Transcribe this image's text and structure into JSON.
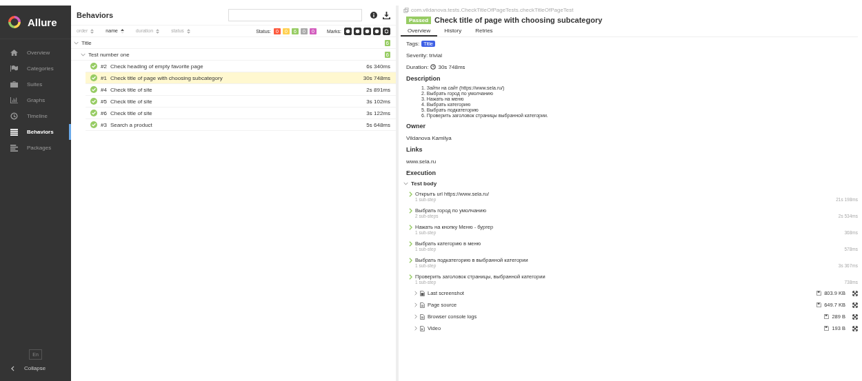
{
  "sidebar": {
    "brand": "Allure",
    "items": [
      {
        "label": "Overview",
        "selected": false
      },
      {
        "label": "Categories",
        "selected": false
      },
      {
        "label": "Suites",
        "selected": false
      },
      {
        "label": "Graphs",
        "selected": false
      },
      {
        "label": "Timeline",
        "selected": false
      },
      {
        "label": "Behaviors",
        "selected": true
      },
      {
        "label": "Packages",
        "selected": false
      }
    ],
    "language": "En",
    "collapse": "Collapse"
  },
  "tree_panel": {
    "title": "Behaviors",
    "sort": [
      {
        "label": "order",
        "selected": false
      },
      {
        "label": "name",
        "selected": true
      },
      {
        "label": "duration",
        "selected": false
      },
      {
        "label": "status",
        "selected": false
      }
    ],
    "status_label": "Status:",
    "status_counts": [
      {
        "value": "0",
        "color": "#fd5a3e"
      },
      {
        "value": "0",
        "color": "#ffd050"
      },
      {
        "value": "6",
        "color": "#97cc64"
      },
      {
        "value": "0",
        "color": "#aaaaaa"
      },
      {
        "value": "0",
        "color": "#d35ebe"
      }
    ],
    "marks_label": "Marks:",
    "marks": [
      {
        "checked": true
      },
      {
        "checked": true
      },
      {
        "checked": true
      },
      {
        "checked": true
      },
      {
        "checked": true
      }
    ],
    "groups": [
      {
        "name": "Title",
        "count": "6",
        "expanded": true,
        "children": [
          {
            "name": "Test number one",
            "count": "6",
            "expanded": true,
            "tests": [
              {
                "index": "#2",
                "name": "Check heading of empty favorite page",
                "duration": "6s 340ms",
                "selected": false
              },
              {
                "index": "#1",
                "name": "Check title of page with choosing subcategory",
                "duration": "30s 748ms",
                "selected": true
              },
              {
                "index": "#4",
                "name": "Check title of site",
                "duration": "2s 891ms",
                "selected": false
              },
              {
                "index": "#5",
                "name": "Check title of site",
                "duration": "3s 102ms",
                "selected": false
              },
              {
                "index": "#6",
                "name": "Check title of site",
                "duration": "3s 122ms",
                "selected": false
              },
              {
                "index": "#3",
                "name": "Search a product",
                "duration": "5s 648ms",
                "selected": false
              }
            ]
          }
        ]
      }
    ]
  },
  "detail": {
    "path": "com.vildanova.tests.CheckTitleOfPageTests.checkTitleOfPageTest",
    "status": "Passed",
    "title": "Check title of page with choosing subcategory",
    "tabs": [
      {
        "label": "Overview",
        "selected": true
      },
      {
        "label": "History",
        "selected": false
      },
      {
        "label": "Retries",
        "selected": false
      }
    ],
    "tags_label": "Tags:",
    "tags": [
      "Title"
    ],
    "severity": "Severity: trivial",
    "duration_label": "Duration:",
    "duration": "30s 748ms",
    "description_heading": "Description",
    "description": [
      "1. Зайти на сайт (https://www.sela.ru/)",
      "2. Выбрать город по умолчанию",
      "3. Нажать на меню",
      "4. Выбрать категорию",
      "5. Выбрать подкатегорию",
      "6. Проверить заголовок страницы выбранной категории."
    ],
    "owner_heading": "Owner",
    "owner": "Vildanova Kamilya",
    "links_heading": "Links",
    "link": "www.sela.ru",
    "execution_heading": "Execution",
    "body_label": "Test body",
    "body_expanded": true,
    "steps": [
      {
        "name": "Открыть url https://www.sela.ru/",
        "substeps": "1 sub-step",
        "duration": "21s 198ms"
      },
      {
        "name": "Выбрать город по умолчанию",
        "substeps": "2 sub-steps",
        "duration": "2s 534ms"
      },
      {
        "name": "Нажать на кнопку Меню - бургер",
        "substeps": "1 sub-step",
        "duration": "368ms"
      },
      {
        "name": "Выбрать категорию в меню",
        "substeps": "1 sub-step",
        "duration": "578ms"
      },
      {
        "name": "Выбрать подкатегорию в выбранной категории",
        "substeps": "1 sub-step",
        "duration": "3s 367ms"
      },
      {
        "name": "Проверить заголовок страницы, выбранной категории",
        "substeps": "1 sub-step",
        "duration": "738ms"
      }
    ],
    "attachments": [
      {
        "name": "Last screenshot",
        "kind": "image",
        "size": "803.9 KB"
      },
      {
        "name": "Page source",
        "kind": "file",
        "size": "649.7 KB"
      },
      {
        "name": "Browser console logs",
        "kind": "file",
        "size": "289 B"
      },
      {
        "name": "Video",
        "kind": "video",
        "size": "193 B"
      }
    ]
  }
}
